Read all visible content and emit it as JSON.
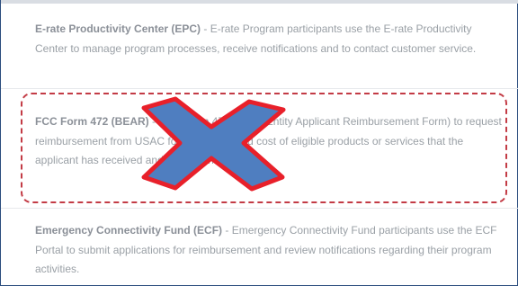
{
  "sections": [
    {
      "title": "E-rate Productivity Center (EPC)",
      "body": " - E-rate Program participants use the E-rate Productivity Center to manage program processes, receive notifications and to contact customer service."
    },
    {
      "title": "FCC Form 472 (BEAR)",
      "body": " - FCC Form 472 (Billed Entity Applicant Reimbursement Form) to request reimbursement from USAC for the discounted cost of eligible products or services that the applicant has received and paid for in full."
    },
    {
      "title": "Emergency Connectivity Fund (ECF)",
      "body": " - Emergency Connectivity Fund participants use the ECF Portal to submit applications for reimbursement and review notifications regarding their program activities."
    }
  ],
  "overlay": {
    "icon": "x-mark-icon",
    "fill_color": "#4f7ec0",
    "stroke_color": "#e8202a",
    "highlight_border_color": "#c33b45"
  }
}
